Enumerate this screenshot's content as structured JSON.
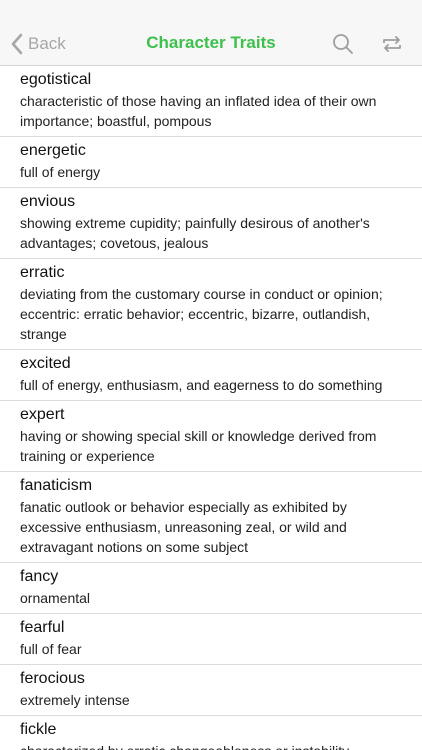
{
  "nav": {
    "back_label": "Back",
    "title": "Character Traits",
    "title_color": "#3ec04c",
    "icons": [
      "chevron-left-icon",
      "search-icon",
      "swap-icon"
    ]
  },
  "entries": [
    {
      "term": "egotistical",
      "definition": "characteristic of those having an inflated idea of their own importance; boastful, pompous"
    },
    {
      "term": "energetic",
      "definition": "full of energy"
    },
    {
      "term": "envious",
      "definition": "showing extreme cupidity; painfully desirous of another's advantages; covetous, jealous"
    },
    {
      "term": "erratic",
      "definition": "deviating from the customary course in conduct or opinion; eccentric: erratic behavior; eccentric, bizarre, outlandish, strange"
    },
    {
      "term": "excited",
      "definition": "full of energy, enthusiasm, and eagerness to do something"
    },
    {
      "term": "expert",
      "definition": "having or showing special skill or knowledge derived from training or experience"
    },
    {
      "term": "fanaticism",
      "definition": "fanatic outlook or behavior especially as exhibited by excessive enthusiasm, unreasoning zeal, or wild and extravagant notions on some subject"
    },
    {
      "term": "fancy",
      "definition": "ornamental"
    },
    {
      "term": "fearful",
      "definition": "full of fear"
    },
    {
      "term": "ferocious",
      "definition": "extremely intense"
    },
    {
      "term": "fickle",
      "definition": "characterized by erratic changeableness or instability, especially with regard to affections or attachments;"
    }
  ]
}
